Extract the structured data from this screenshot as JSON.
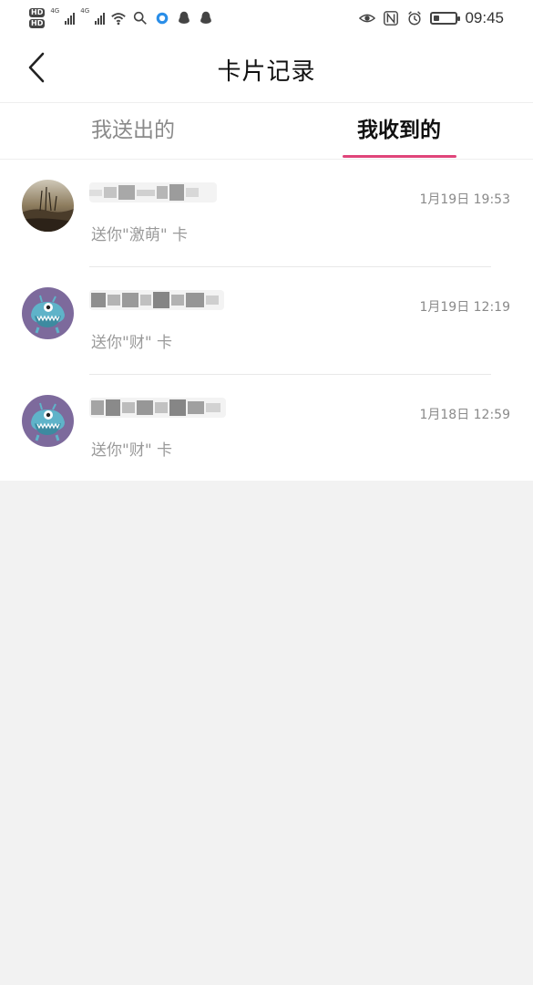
{
  "status_bar": {
    "hd1": "HD",
    "hd2": "HD",
    "net1": "4G",
    "net2": "4G",
    "time": "09:45",
    "battery_level": 0.25
  },
  "navbar": {
    "title": "卡片记录",
    "back_icon": "chevron-left-icon"
  },
  "tabs": [
    {
      "label": "我送出的",
      "active": false
    },
    {
      "label": "我收到的",
      "active": true
    }
  ],
  "accent_color": "#e0457a",
  "records": [
    {
      "avatar": "photo-avatar",
      "message": "送你\"激萌\" 卡",
      "date": "1月19日 19:53"
    },
    {
      "avatar": "monster-avatar",
      "message": "送你\"财\" 卡",
      "date": "1月19日 12:19"
    },
    {
      "avatar": "monster-avatar",
      "message": "送你\"财\" 卡",
      "date": "1月18日 12:59"
    }
  ]
}
